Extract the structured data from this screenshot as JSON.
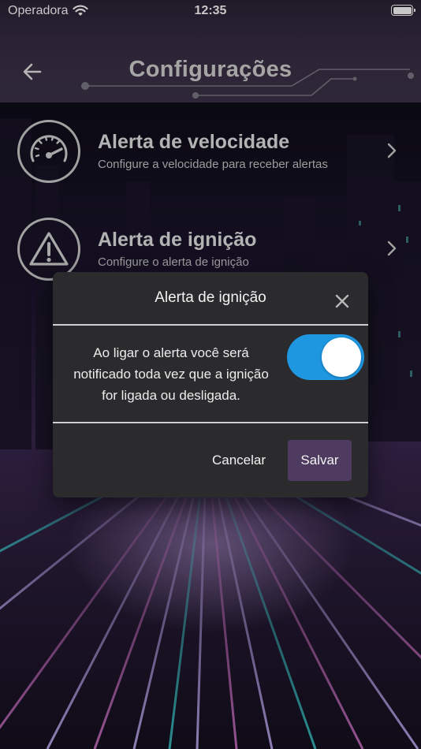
{
  "status_bar": {
    "carrier": "Operadora",
    "time": "12:35",
    "wifi_icon": "wifi-icon",
    "battery_icon": "battery-icon",
    "battery_level": 1.0
  },
  "header": {
    "title": "Configurações",
    "back_icon": "arrow-left-icon"
  },
  "settings": {
    "items": [
      {
        "title": "Alerta de velocidade",
        "subtitle": "Configure a velocidade para receber alertas",
        "icon": "speedometer-icon"
      },
      {
        "title": "Alerta de ignição",
        "subtitle": "Configure o alerta de ignição",
        "icon": "warning-triangle-icon"
      }
    ]
  },
  "dialog": {
    "title": "Alerta de ignição",
    "message": "Ao ligar o alerta você será notificado toda vez que a ignição for ligada ou desligada.",
    "toggle_on": true,
    "cancel_label": "Cancelar",
    "save_label": "Salvar",
    "close_icon": "close-icon"
  },
  "colors": {
    "accent_toggle": "#1e96e0",
    "save_button": "#4e3b5f",
    "dialog_bg": "#2b2b2e",
    "header_bg": "#3a3046"
  }
}
